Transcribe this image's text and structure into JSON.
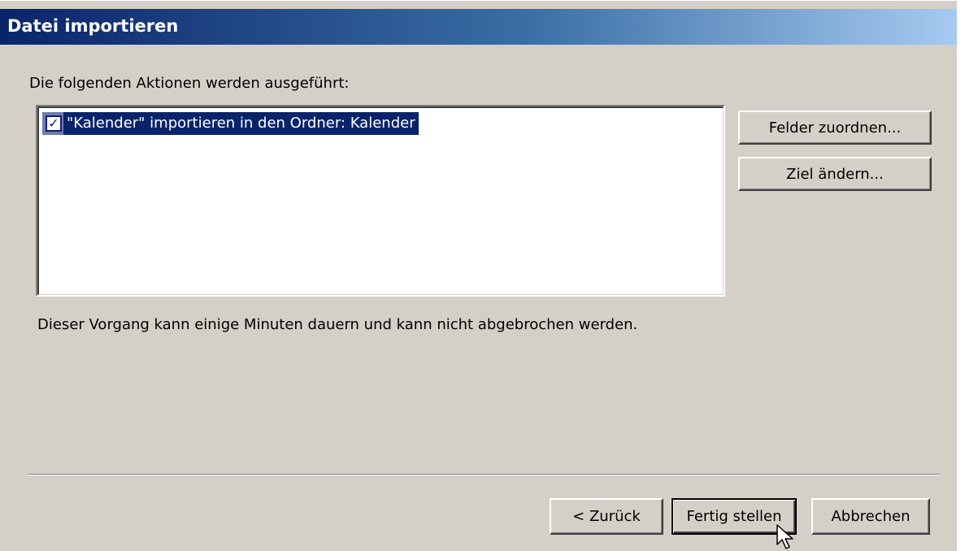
{
  "dialog": {
    "title": "Datei importieren"
  },
  "actions": {
    "label": "Die folgenden Aktionen werden ausgeführt:",
    "items": [
      {
        "checked": true,
        "text": "\"Kalender\" importieren in den Ordner: Kalender"
      }
    ]
  },
  "side_buttons": {
    "map_fields": "Felder zuordnen...",
    "change_destination": "Ziel ändern..."
  },
  "note": "Dieser Vorgang kann einige Minuten dauern und kann nicht abgebrochen werden.",
  "footer": {
    "back": "< Zurück",
    "finish": "Fertig stellen",
    "cancel": "Abbrechen"
  },
  "colors": {
    "title_start": "#0a246a",
    "title_end": "#a6caf0",
    "dialog_bg": "#d4d0c8",
    "selection_bg": "#0a246a"
  },
  "icons": {
    "check": "checkmark-icon",
    "cursor": "arrow-cursor-icon"
  }
}
